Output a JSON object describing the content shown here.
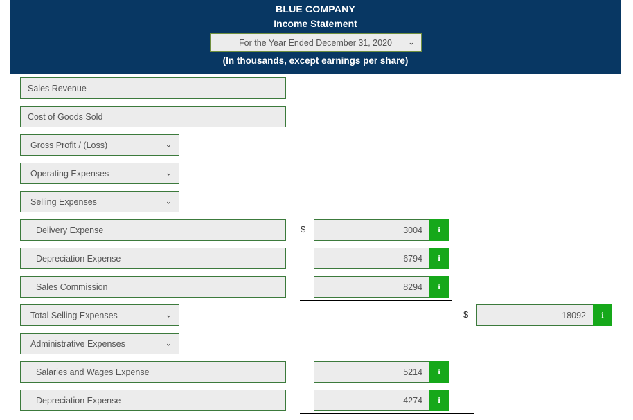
{
  "header": {
    "company": "BLUE COMPANY",
    "statement": "Income Statement",
    "period_selected": "For the Year Ended December 31, 2020",
    "units_note": "(In thousands, except earnings per share)",
    "navy": "#083763"
  },
  "icons": {
    "chevron": "⌄",
    "info": "i",
    "dollar": "$"
  },
  "rows": [
    {
      "label": "Sales Revenue",
      "kind": "input",
      "indent": false
    },
    {
      "label": "Cost of Goods Sold",
      "kind": "input",
      "indent": false
    },
    {
      "label": "Gross Profit / (Loss)",
      "kind": "select",
      "indent": false
    },
    {
      "label": "Operating Expenses",
      "kind": "select",
      "indent": false
    },
    {
      "label": "Selling Expenses",
      "kind": "select",
      "indent": false
    },
    {
      "label": "Delivery Expense",
      "kind": "input",
      "indent": true,
      "amount": {
        "column": "a",
        "value": "3004",
        "dollar": true
      }
    },
    {
      "label": "Depreciation Expense",
      "kind": "input",
      "indent": true,
      "amount": {
        "column": "a",
        "value": "6794",
        "dollar": false
      }
    },
    {
      "label": "Sales Commission",
      "kind": "input",
      "indent": true,
      "amount": {
        "column": "a",
        "value": "8294",
        "dollar": false
      },
      "rule_below": "a"
    },
    {
      "label": "Total Selling Expenses",
      "kind": "select",
      "indent": false,
      "amount": {
        "column": "b",
        "value": "18092",
        "dollar": true
      }
    },
    {
      "label": "Administrative Expenses",
      "kind": "select",
      "indent": false
    },
    {
      "label": "Salaries and Wages Expense",
      "kind": "input",
      "indent": true,
      "amount": {
        "column": "a",
        "value": "5214",
        "dollar": false
      }
    },
    {
      "label": "Depreciation Expense",
      "kind": "input",
      "indent": true,
      "amount": {
        "column": "a",
        "value": "4274",
        "dollar": false
      },
      "rule_below": "b"
    }
  ]
}
